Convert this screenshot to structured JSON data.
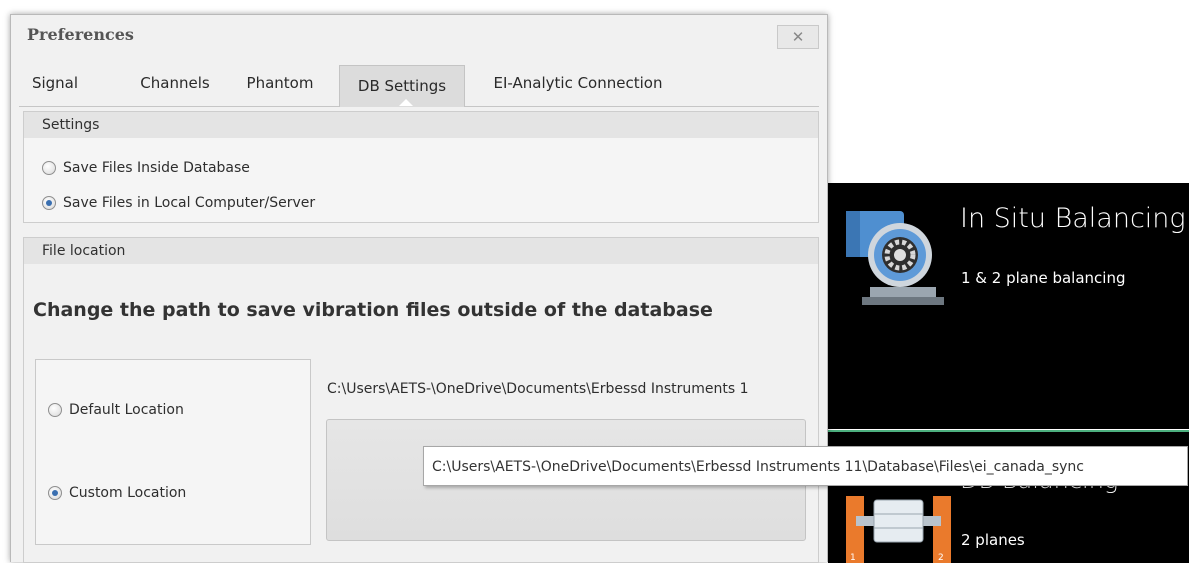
{
  "window": {
    "title": "Preferences",
    "close_label": "✕"
  },
  "tabs": [
    {
      "label": "Signal"
    },
    {
      "label": "Channels"
    },
    {
      "label": "Phantom"
    },
    {
      "label": "DB Settings",
      "active": true
    },
    {
      "label": "EI-Analytic Connection"
    }
  ],
  "settings": {
    "header": "Settings",
    "options": [
      {
        "label": "Save Files Inside Database",
        "selected": false
      },
      {
        "label": "Save Files in Local Computer/Server",
        "selected": true
      }
    ]
  },
  "file_location": {
    "header": "File location",
    "heading": "Change the path to save vibration files outside of the database",
    "options": [
      {
        "label": "Default Location",
        "selected": false
      },
      {
        "label": "Custom Location",
        "selected": true
      }
    ],
    "path_display": "C:\\Users\\AETS-\\OneDrive\\Documents\\Erbessd Instruments 1",
    "tooltip": "C:\\Users\\AETS-\\OneDrive\\Documents\\Erbessd Instruments 11\\Database\\Files\\ei_canada_sync"
  },
  "background_app": {
    "tiles": [
      {
        "title": "In Situ Balancing",
        "subtitle": "1 & 2 plane balancing",
        "icon": "blower-fan-icon"
      },
      {
        "title": "DB Balancing",
        "subtitle": "2 planes",
        "icon": "rotor-shaft-icon"
      }
    ]
  },
  "colors": {
    "accent": "#3a6fb0",
    "tile_bg": "#000000",
    "tile_divider": "#4caf7e",
    "fan_blue": "#4f8fd0"
  }
}
